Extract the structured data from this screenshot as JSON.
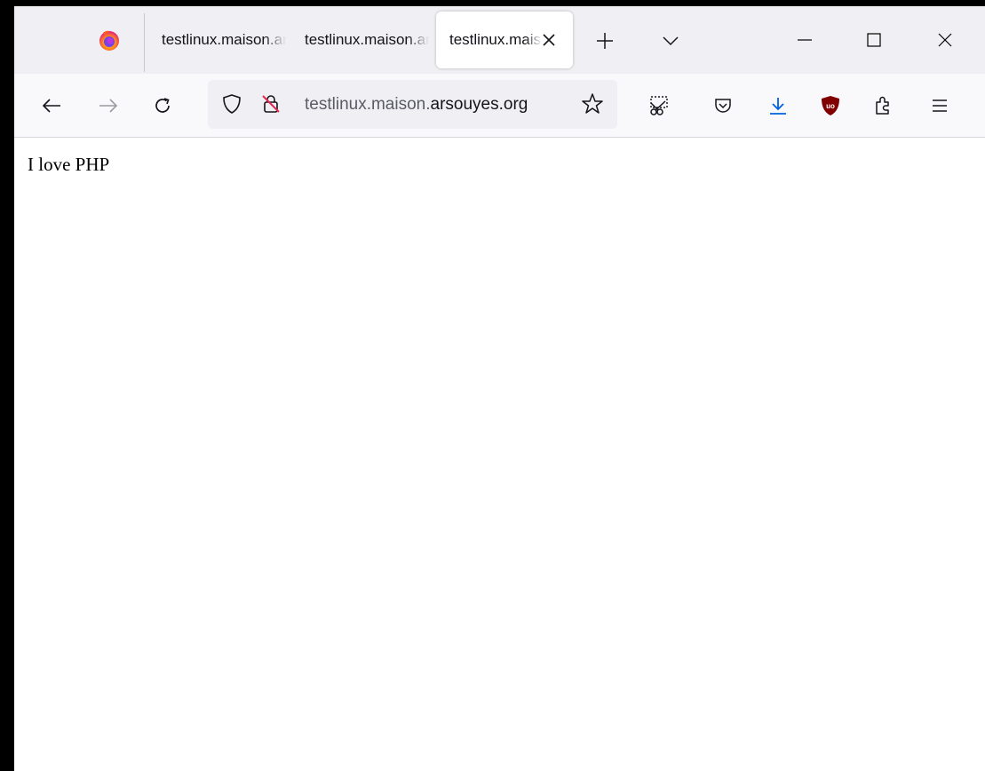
{
  "browser": {
    "tabs": [
      {
        "title": "testlinux.maison.arsouyes.org",
        "active": false
      },
      {
        "title": "testlinux.maison.arsouyes.org",
        "active": false
      },
      {
        "title": "testlinux.maison.arsouyes.org",
        "active": true
      }
    ],
    "url": {
      "prefix": "testlinux.maison.",
      "domain": "arsouyes.org"
    },
    "icons": {
      "firefox": "firefox-logo-icon",
      "close_tab": "close-icon",
      "new_tab": "plus-icon",
      "tab_list": "chevron-down-icon",
      "minimize": "minimize-icon",
      "maximize": "maximize-icon",
      "close_window": "close-icon",
      "back": "arrow-left-icon",
      "forward": "arrow-right-icon",
      "reload": "reload-icon",
      "tracking_protection": "shield-icon",
      "insecure": "lock-insecure-icon",
      "bookmark": "star-icon",
      "screenshot": "screenshot-icon",
      "pocket": "pocket-icon",
      "downloads": "download-icon",
      "ublock": "ublock-origin-icon",
      "extensions": "puzzle-icon",
      "menu": "hamburger-menu-icon"
    },
    "colors": {
      "tab_strip": "#f0f0f4",
      "toolbar": "#f9f9fb",
      "download_accent": "#0061e0",
      "ublock_red": "#800000",
      "insecure_red": "#e22850"
    }
  },
  "page": {
    "text": "I love PHP"
  }
}
